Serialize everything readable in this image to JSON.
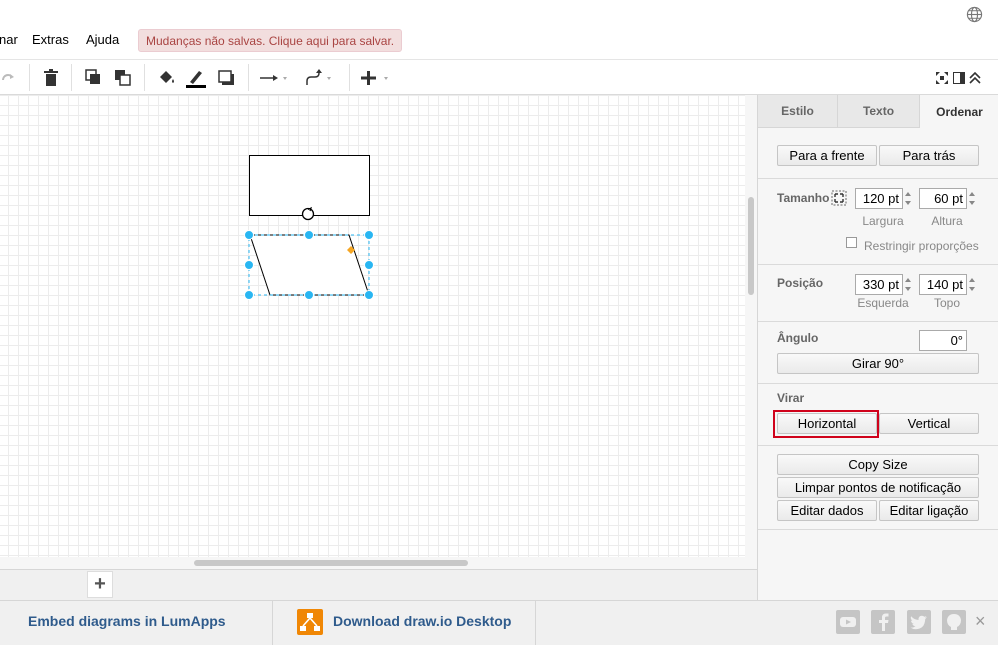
{
  "menubar": {
    "items": [
      "nar",
      "Extras",
      "Ajuda"
    ],
    "unsaved_notice": "Mudanças não salvas. Clique aqui para salvar."
  },
  "toolbar": {
    "icons": [
      "redo-icon",
      "delete-icon",
      "to-front-icon",
      "to-back-icon",
      "fill-color-icon",
      "line-color-icon",
      "shadow-icon",
      "connection-icon",
      "waypoints-icon",
      "insert-icon",
      "fullscreen-icon",
      "format-panel-icon",
      "collapse-icon"
    ]
  },
  "canvas": {
    "shapes": [
      "rectangle",
      "parallelogram"
    ]
  },
  "pages": {
    "add_label": "+"
  },
  "panel": {
    "tabs": [
      {
        "label": "Estilo",
        "active": false
      },
      {
        "label": "Texto",
        "active": false
      },
      {
        "label": "Ordenar",
        "active": true
      }
    ],
    "order": {
      "front_label": "Para a frente",
      "back_label": "Para trás"
    },
    "size": {
      "label": "Tamanho",
      "width": "120 pt",
      "height": "60 pt",
      "width_label": "Largura",
      "height_label": "Altura",
      "constrain_label": "Restringir proporções"
    },
    "position": {
      "label": "Posição",
      "left": "330 pt",
      "top": "140 pt",
      "left_label": "Esquerda",
      "top_label": "Topo"
    },
    "angle": {
      "label": "Ângulo",
      "value": "0°",
      "rotate_label": "Girar 90°"
    },
    "flip": {
      "label": "Virar",
      "horizontal_label": "Horizontal",
      "vertical_label": "Vertical"
    },
    "actions": {
      "copy_size": "Copy Size",
      "clear_waypoints": "Limpar pontos de notificação",
      "edit_data": "Editar dados",
      "edit_link": "Editar ligação"
    }
  },
  "footer": {
    "embed_label": "Embed diagrams in LumApps",
    "download_label": "Download draw.io Desktop",
    "close_label": "×",
    "social": [
      "youtube-icon",
      "facebook-icon",
      "twitter-icon",
      "github-icon"
    ]
  },
  "colors": {
    "selection": "#29b6f2",
    "handle_yellow": "#f5a623",
    "highlight": "#d0021b",
    "link": "#2f5b8c"
  }
}
